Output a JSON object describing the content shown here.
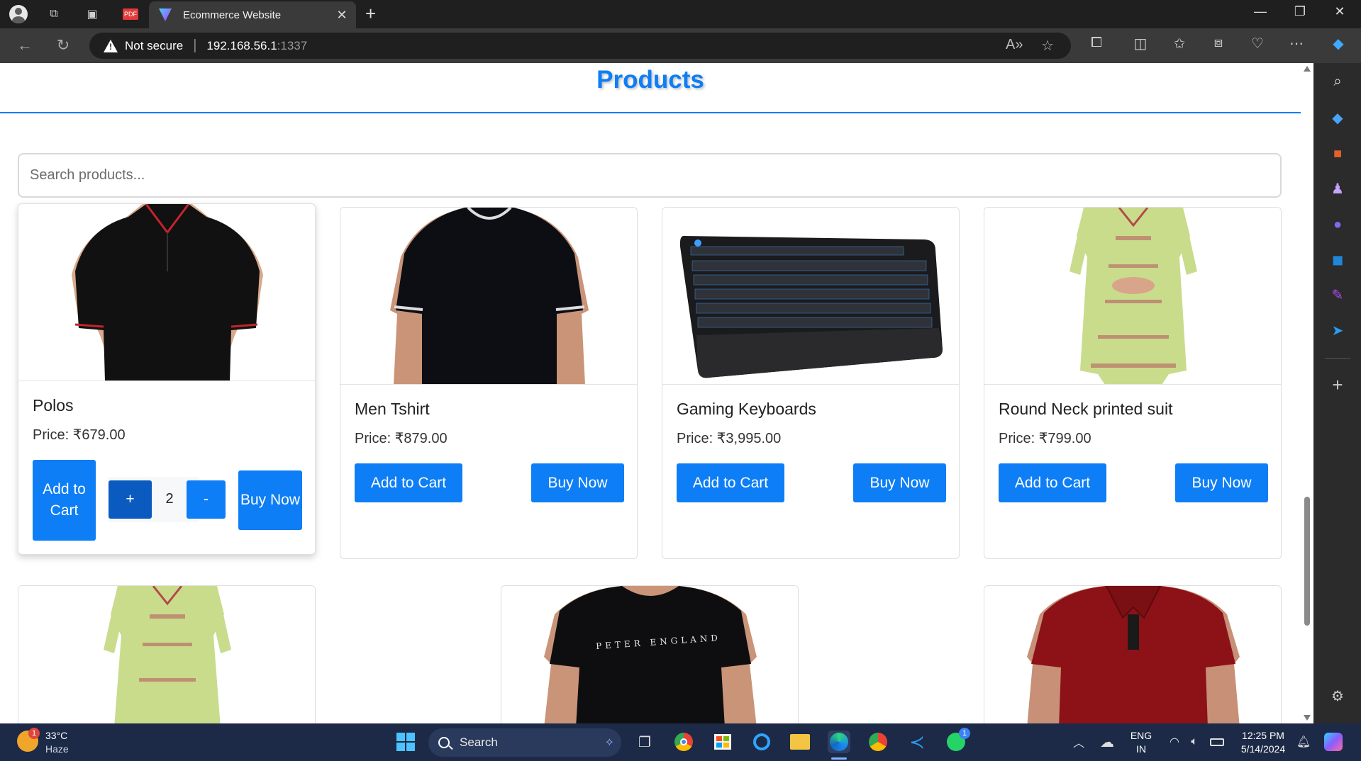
{
  "browser": {
    "tab_title": "Ecommerce Website",
    "address_security": "Not secure",
    "address_host": "192.168.56.1",
    "address_port": ":1337"
  },
  "page": {
    "title": "Products",
    "search_placeholder": "Search products..."
  },
  "products": [
    {
      "name": "Polos",
      "price": "Price: ₹679.00",
      "add_label": "Add to Cart",
      "buy_label": "Buy Now",
      "qty": "2",
      "plus": "+",
      "minus": "-"
    },
    {
      "name": "Men Tshirt",
      "price": "Price: ₹879.00",
      "add_label": "Add to Cart",
      "buy_label": "Buy Now"
    },
    {
      "name": "Gaming Keyboards",
      "price": "Price: ₹3,995.00",
      "add_label": "Add to Cart",
      "buy_label": "Buy Now"
    },
    {
      "name": "Round Neck printed suit",
      "price": "Price: ₹799.00",
      "add_label": "Add to Cart",
      "buy_label": "Buy Now"
    }
  ],
  "product_images_row2": [
    {
      "icon": "kurta-image",
      "brand_text": ""
    },
    {
      "icon": "tshirt-image",
      "brand_text": "PETER ENGLAND"
    },
    {
      "icon": "polo-red-image",
      "brand_text": ""
    }
  ],
  "taskbar": {
    "weather_temp": "33°C",
    "weather_desc": "Haze",
    "weather_badge": "1",
    "search_label": "Search",
    "lang_1": "ENG",
    "lang_2": "IN",
    "time": "12:25 PM",
    "date": "5/14/2024",
    "whatsapp_badge": "1"
  },
  "colors": {
    "accent": "#0d7ef5",
    "chrome_dark": "#1f1f1f",
    "taskbar": "#1c2a47"
  }
}
